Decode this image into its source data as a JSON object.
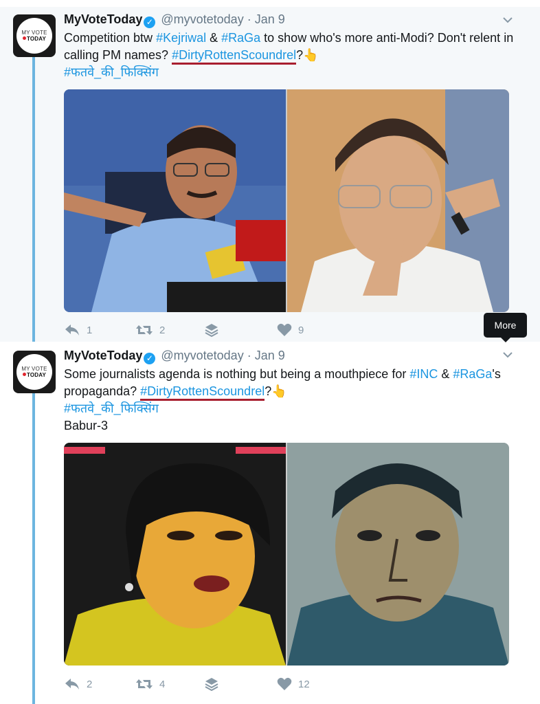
{
  "tweets": [
    {
      "avatar": {
        "line1": "MY VOTE",
        "line2": "TODAY"
      },
      "name": "MyVoteToday",
      "handle": "@myvotetoday",
      "sep": "·",
      "date": "Jan 9",
      "text": {
        "p1": "Competition btw ",
        "tag1": "#Kejriwal",
        "p2": " & ",
        "tag2": "#RaGa",
        "p3": " to show who's more anti-Modi? Don't relent in calling PM names? ",
        "tag3": "#DirtyRottenScoundrel",
        "p4": "?",
        "emoji": "👆",
        "tag4": "#फतवे_की_फिक्सिंग"
      },
      "actions": {
        "replies": "1",
        "retweets": "2",
        "likes": "9"
      }
    },
    {
      "avatar": {
        "line1": "MY VOTE",
        "line2": "TODAY"
      },
      "name": "MyVoteToday",
      "handle": "@myvotetoday",
      "sep": "·",
      "date": "Jan 9",
      "text": {
        "p1": "Some journalists agenda is nothing but being a mouthpiece for ",
        "tag1": "#INC",
        "p2": " & ",
        "tag2": "#RaGa",
        "p3": "'s propaganda? ",
        "tag3": "#DirtyRottenScoundrel",
        "p4": "?",
        "emoji": "👆",
        "tag4": "#फतवे_की_फिक्सिंग",
        "extra": "Babur-3"
      },
      "actions": {
        "replies": "2",
        "retweets": "4",
        "likes": "12"
      }
    }
  ],
  "tooltip": {
    "label": "More"
  },
  "colors": {
    "link": "#1b95e0",
    "thread": "#6cb5df",
    "underline": "#a81e2e",
    "muted": "#8899a6"
  }
}
